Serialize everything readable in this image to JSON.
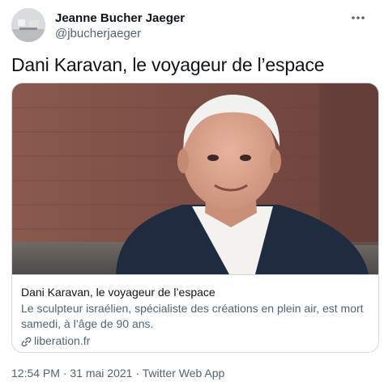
{
  "author": {
    "display_name": "Jeanne Bucher Jaeger",
    "handle": "@jbucherjaeger"
  },
  "tweet": {
    "text": "Dani Karavan, le voyageur de l’espace"
  },
  "card": {
    "title": "Dani Karavan, le voyageur de l’espace",
    "description": "Le sculpteur israélien, spécialiste des créations en plein air, est mort samedi, à l’âge de 90 ans.",
    "domain": "liberation.fr"
  },
  "meta": {
    "time": "12:54 PM",
    "separator": "·",
    "date": "31 mai 2021",
    "source": "Twitter Web App"
  },
  "icons": {
    "more": "more-options-icon",
    "link": "link-icon"
  },
  "colors": {
    "text_primary": "#0f1419",
    "text_secondary": "#536471",
    "border": "#cfd9de"
  }
}
